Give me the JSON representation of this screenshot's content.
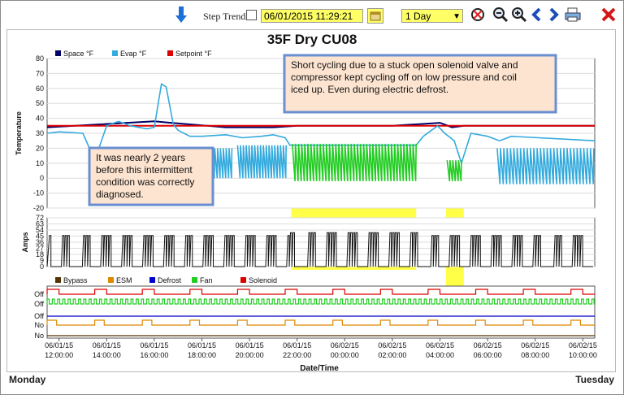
{
  "toolbar": {
    "step_trends_label": "Step Trends:",
    "datetime_value": "06/01/2015 11:29:21",
    "range_value": "1 Day"
  },
  "footer": {
    "left": "Monday",
    "right": "Tuesday"
  },
  "colors": {
    "space": "#000066",
    "evap": "#33aadd",
    "setpoint": "#dd0000",
    "bypass": "#553300",
    "esm": "#dd8800",
    "defrost": "#0000cc",
    "fan": "#22cc22",
    "solenoid": "#dd0000",
    "highlight": "#ffff33",
    "note_fill": "#fde4d0",
    "note_border": "#6a8fd0"
  },
  "icons": [
    "down-arrow-icon",
    "calendar-icon",
    "reset-icon",
    "zoom-out-icon",
    "zoom-in-icon",
    "previous-icon",
    "next-icon",
    "print-icon",
    "close-icon"
  ],
  "chart_data": {
    "type": "line",
    "title": "35F Dry CU08",
    "xlabel": "Date/Time",
    "x_ticks": [
      [
        "06/01/15",
        "12:00:00"
      ],
      [
        "06/01/15",
        "14:00:00"
      ],
      [
        "06/01/15",
        "16:00:00"
      ],
      [
        "06/01/15",
        "18:00:00"
      ],
      [
        "06/01/15",
        "20:00:00"
      ],
      [
        "06/01/15",
        "22:00:00"
      ],
      [
        "06/02/15",
        "00:00:00"
      ],
      [
        "06/02/15",
        "02:00:00"
      ],
      [
        "06/02/15",
        "04:00:00"
      ],
      [
        "06/02/15",
        "06:00:00"
      ],
      [
        "06/02/15",
        "08:00:00"
      ],
      [
        "06/02/15",
        "10:00:00"
      ]
    ],
    "x_range_hours": [
      11.5,
      34.5
    ],
    "highlights_hours": [
      [
        21.75,
        27.0
      ],
      [
        28.25,
        29.0
      ]
    ],
    "temperature": {
      "ylabel": "Temperature",
      "ylim": [
        -20,
        80
      ],
      "yticks": [
        -20,
        -10,
        0,
        10,
        20,
        30,
        40,
        50,
        60,
        70,
        80
      ],
      "legend": [
        "Space °F",
        "Evap °F",
        "Setpoint °F"
      ],
      "series": [
        {
          "name": "Space °F",
          "x": [
            11.5,
            16,
            16.7,
            19,
            21,
            22,
            26,
            28,
            28.5,
            29,
            34.5
          ],
          "y": [
            34,
            38,
            37,
            34,
            34,
            35,
            35,
            37,
            34,
            35,
            35
          ]
        },
        {
          "name": "Setpoint °F",
          "x": [
            11.5,
            34.5
          ],
          "y": [
            35,
            35
          ]
        },
        {
          "name": "Evap °F",
          "x": [
            11.5,
            12,
            13,
            13.5,
            14,
            14.5,
            15,
            15.7,
            16,
            16.3,
            16.5,
            16.8,
            17,
            17.5,
            18,
            19,
            19.7,
            20.5,
            21,
            21.5,
            21.7,
            27,
            27.3,
            27.9,
            28.2,
            28.6,
            28.9,
            29.3,
            30,
            30.5,
            31,
            34.5
          ],
          "y": [
            30,
            31,
            30,
            12,
            35,
            38,
            35,
            33,
            34,
            63,
            61,
            36,
            32,
            28,
            28,
            29,
            27,
            28,
            29,
            27,
            22,
            22,
            28,
            35,
            30,
            25,
            10,
            30,
            28,
            25,
            28,
            25
          ]
        }
      ],
      "annotations": [
        "Short cycling due to a stuck open solenoid valve and compressor kept cycling off on low pressure and coil iced up. Even during electric defrost.",
        "It was nearly 2 years before this intermittent condition was correctly diagnosed."
      ]
    },
    "amps": {
      "ylabel": "Amps",
      "ylim": [
        0,
        72
      ],
      "yticks": [
        0,
        9,
        18,
        27,
        36,
        45,
        54,
        63,
        72
      ]
    },
    "status": {
      "legend": [
        "Bypass",
        "ESM",
        "Defrost",
        "Fan",
        "Solenoid"
      ],
      "yticks": [
        "Off",
        "Off",
        "Off",
        "No",
        "No"
      ]
    }
  }
}
